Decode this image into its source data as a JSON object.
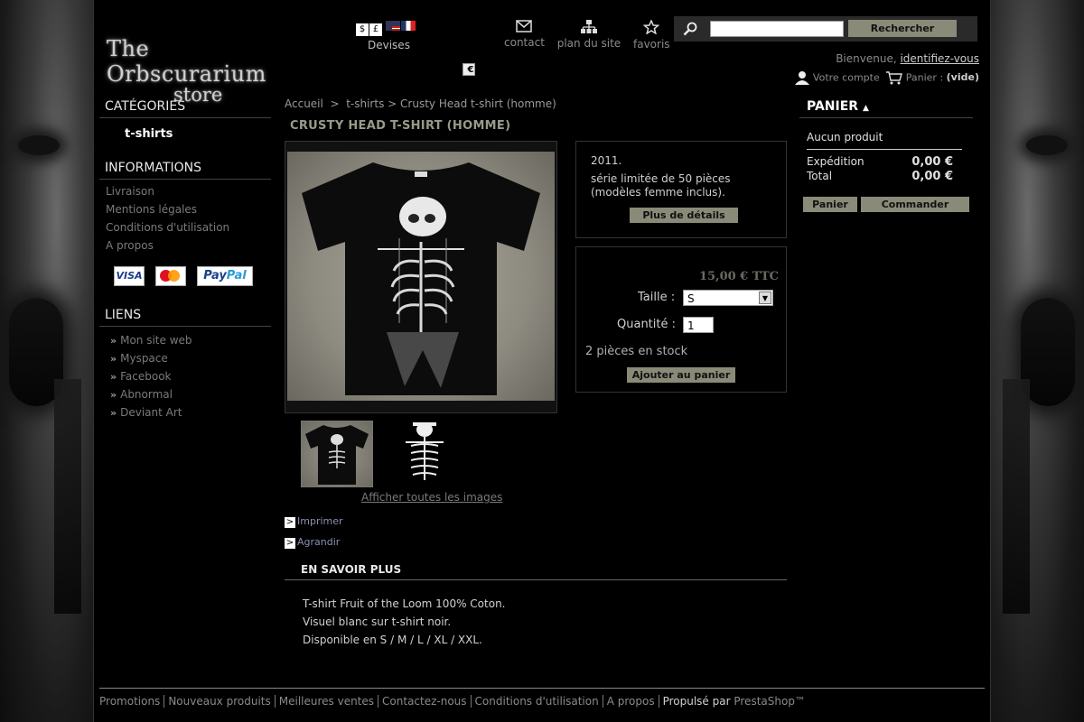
{
  "header": {
    "logo_line1": "The Orbscurarium",
    "logo_line2": "store",
    "currency_symbols": [
      "$",
      "€",
      "£"
    ],
    "currency_label": "Devises",
    "links": {
      "contact": "contact",
      "sitemap": "plan du site",
      "favorites": "favoris"
    },
    "search": {
      "button": "Rechercher",
      "value": ""
    },
    "welcome": "Bienvenue,",
    "login_link": "identifiez-vous",
    "account": "Votre compte",
    "cart_label": "Panier :",
    "cart_state": "(vide)"
  },
  "left": {
    "categories_title": "CATÉGORIES",
    "categories": [
      "t-shirts"
    ],
    "info_title": "INFORMATIONS",
    "info_items": [
      "Livraison",
      "Mentions légales",
      "Conditions d'utilisation",
      "A propos"
    ],
    "payment": {
      "visa": "VISA",
      "paypal_a": "Pay",
      "paypal_b": "Pal"
    },
    "links_title": "LIENS",
    "link_items": [
      "Mon site web",
      "Myspace",
      "Facebook",
      "Abnormal",
      "Deviant Art"
    ]
  },
  "product": {
    "breadcrumb": [
      "Accueil",
      ">",
      "t-shirts",
      ">",
      "Crusty Head t-shirt (homme)"
    ],
    "title": "CRUSTY HEAD T-SHIRT (HOMME)",
    "short_desc_1": "2011.",
    "short_desc_2": "série limitée de 50 pièces (modèles femme inclus).",
    "details_button": "Plus de détails",
    "price": "15,00 € TTC",
    "size_label": "Taille :",
    "size_value": "S",
    "qty_label": "Quantité :",
    "qty_value": "1",
    "stock": "2 pièces en stock",
    "add_button": "Ajouter au panier",
    "all_images": "Afficher toutes les images",
    "print": "Imprimer",
    "enlarge": "Agrandir",
    "more_title": "EN SAVOIR PLUS",
    "more_lines": [
      "T-shirt Fruit of the Loom 100% Coton.",
      "Visuel blanc sur t-shirt noir.",
      "Disponible en S / M / L / XL / XXL."
    ]
  },
  "cart": {
    "title": "PANIER",
    "empty": "Aucun produit",
    "shipping_label": "Expédition",
    "shipping_value": "0,00 €",
    "total_label": "Total",
    "total_value": "0,00 €",
    "cart_button": "Panier",
    "order_button": "Commander"
  },
  "footer": {
    "links": [
      "Promotions",
      "Nouveaux produits",
      "Meilleures ventes",
      "Contactez-nous",
      "Conditions d'utilisation",
      "A propos"
    ],
    "powered_prefix": "Propulsé par",
    "powered_name": "PrestaShop™"
  },
  "colors": {
    "button": "#8a8a78",
    "background": "#000000",
    "price": "#6a6a62"
  }
}
